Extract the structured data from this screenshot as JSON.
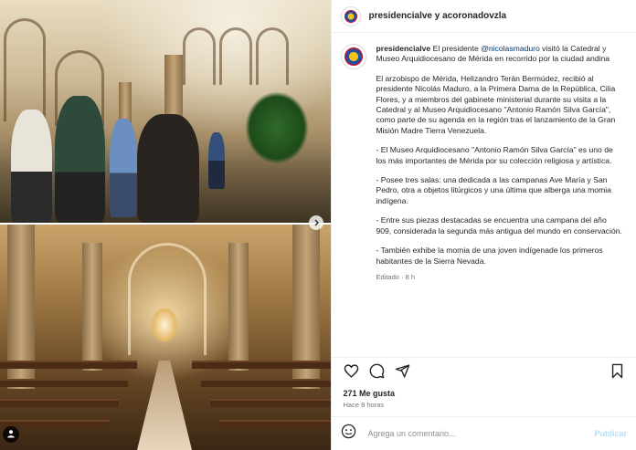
{
  "post": {
    "header": {
      "account": "presidencialve",
      "connector": "y",
      "collaborator": "acoronadovzla"
    },
    "caption": {
      "username": "presidencialve",
      "intro_before_mention": "El presidente",
      "mention": "@nicolasmaduro",
      "intro_after_mention": "visitó la Catedral y Museo Arquidiocesano de Mérida en recorrido por la ciudad andina",
      "paragraphs": [
        "El arzobispo de Mérida, Helizandro Terán Bermúdez, recibió al presidente Nicolás Maduro, a la Primera Dama de la República, Cilia Flores, y a miembros del gabinete ministerial durante su visita a la Catedral y al Museo Arquidiocesano \"Antonio Ramón Silva García\", como parte de su agenda en la región tras el lanzamiento de la Gran Misión Madre Tierra Venezuela.",
        "- El Museo Arquidiocesano \"Antonio Ramón Silva García\" es uno de los más importantes de Mérida por su colección religiosa y artística.",
        "- Posee tres salas: una dedicada a las campanas Ave María y San Pedro, otra a objetos litúrgicos y una última que alberga una momia indígena.",
        "- Entre sus piezas destacadas se encuentra una campana del año 909, considerada la segunda más antigua del mundo en conservación.",
        "- También exhibe la momia de una joven indígenade los primeros habitantes de la Sierra Nevada."
      ],
      "edited": "Editado · 8 h"
    },
    "actions": {
      "like_icon": "heart-icon",
      "comment_icon": "comment-icon",
      "share_icon": "share-icon",
      "save_icon": "bookmark-icon"
    },
    "likes": "271 Me gusta",
    "time_ago": "Hace 8 horas",
    "comment": {
      "placeholder": "Agrega un comentario...",
      "publish_label": "Publicar",
      "emoji_icon": "emoji-icon"
    },
    "media": {
      "next_icon": "chevron-right-icon",
      "user_tag_icon": "person-icon"
    },
    "colors": {
      "mention": "#00376b",
      "publish_disabled": "#b2dffc",
      "secondary_text": "#737373"
    }
  }
}
